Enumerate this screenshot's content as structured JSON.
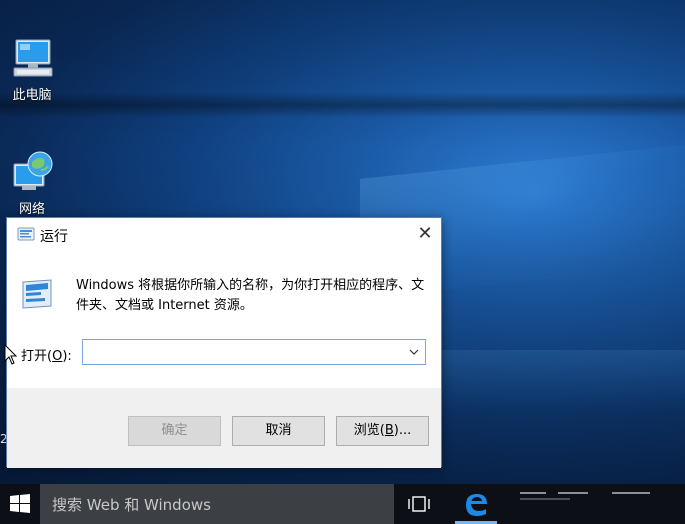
{
  "desktop": {
    "icons": [
      {
        "label": "此电脑",
        "icon": "computer-icon"
      },
      {
        "label": "网络",
        "icon": "network-globe-icon"
      }
    ],
    "side_mark": "2"
  },
  "run_dialog": {
    "title": "运行",
    "close_glyph": "✕",
    "message": "Windows 将根据你所输入的名称，为你打开相应的程序、文件夹、文档或 Internet 资源。",
    "open_label_prefix": "打开(",
    "open_label_key": "O",
    "open_label_suffix": "):",
    "command_value": "",
    "buttons": {
      "ok": "确定",
      "cancel": "取消",
      "browse_prefix": "浏览(",
      "browse_key": "B",
      "browse_suffix": ")..."
    }
  },
  "taskbar": {
    "search_placeholder": "搜索 Web 和 Windows",
    "icons": [
      "windows-start-icon",
      "task-view-icon",
      "edge-browser-icon"
    ]
  },
  "colors": {
    "accent": "#0078d7",
    "taskbar": "#0c0f16",
    "search_box": "#3c3f44",
    "dialog_border": "#5a7fae"
  }
}
